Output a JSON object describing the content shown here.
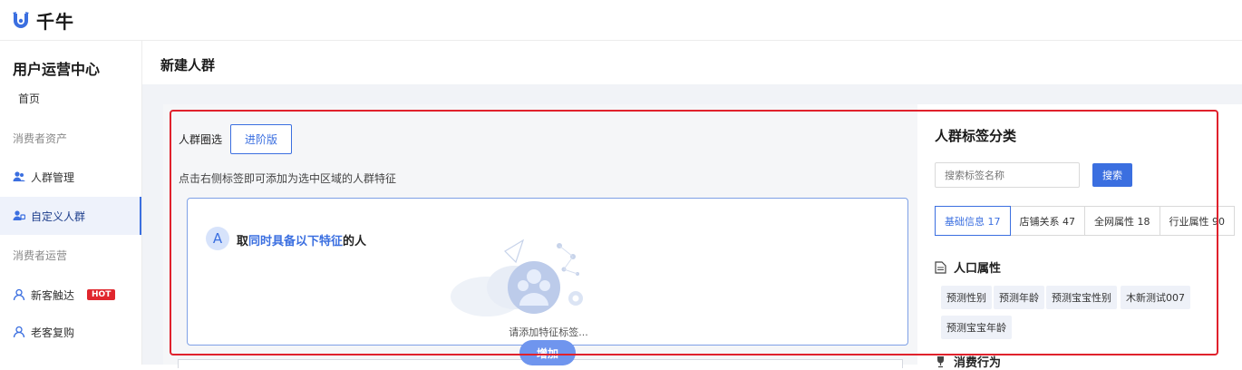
{
  "app": {
    "logo_text": "千牛",
    "brand_color": "#3b6fe0"
  },
  "sidebar": {
    "title": "用户运营中心",
    "home": "首页",
    "group_assets": "消费者资产",
    "items_assets": [
      {
        "label": "人群管理",
        "icon": "users-icon"
      },
      {
        "label": "自定义人群",
        "icon": "users-custom-icon",
        "active": true
      }
    ],
    "group_ops": "消费者运营",
    "items_ops": [
      {
        "label": "新客触达",
        "icon": "user-icon",
        "badge": "HOT"
      },
      {
        "label": "老客复购",
        "icon": "user-icon"
      }
    ]
  },
  "page": {
    "title": "新建人群"
  },
  "left": {
    "circle_label": "人群圈选",
    "advanced_button": "进阶版",
    "hint": "点击右侧标签即可添加为选中区域的人群特征",
    "group_letter": "A",
    "cond_prefix": "取",
    "cond_highlight": "同时具备以下特征",
    "cond_suffix": "的人",
    "empty_text": "请添加特征标签...",
    "add_button": "增加"
  },
  "right": {
    "title": "人群标签分类",
    "search_placeholder": "搜索标签名称",
    "search_button": "搜索",
    "tabs": [
      {
        "label": "基础信息 17",
        "active": true
      },
      {
        "label": "店铺关系 47"
      },
      {
        "label": "全网属性 18"
      },
      {
        "label": "行业属性 90"
      }
    ],
    "section1": "人口属性",
    "tags": [
      "预测性别",
      "预测年龄",
      "预测宝宝性别",
      "木新测试007",
      "预测宝宝年龄"
    ],
    "section2": "消费行为"
  },
  "colors": {
    "highlight_frame": "#e0212c",
    "active_bg": "#eef2fb"
  }
}
